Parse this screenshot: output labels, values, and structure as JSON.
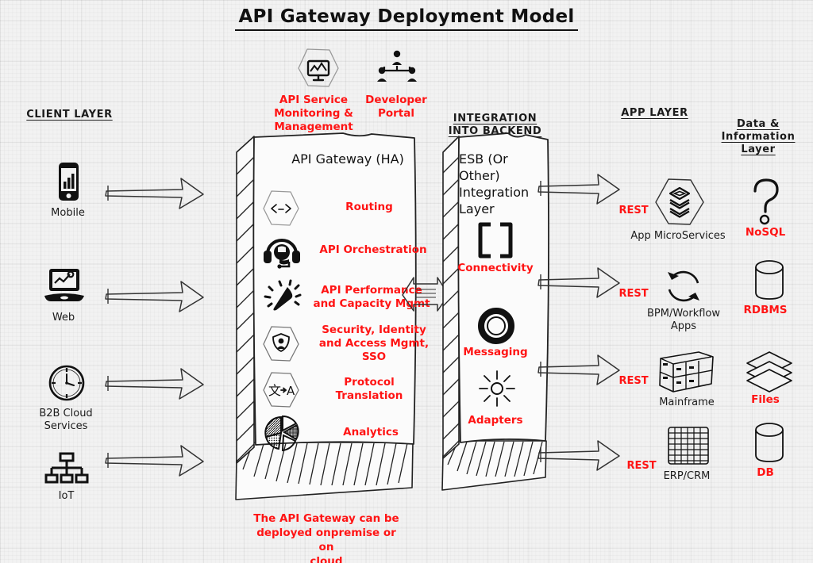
{
  "title": "API Gateway Deployment Model",
  "top_icons": [
    {
      "name": "api-service-monitoring",
      "label": "API Service\nMonitoring &\nManagement",
      "icon": "monitor-hexagon-icon"
    },
    {
      "name": "developer-portal",
      "label": "Developer Portal",
      "icon": "people-org-icon"
    }
  ],
  "layers": {
    "client": "CLIENT LAYER",
    "integration": "INTEGRATION\nINTO BACKEND",
    "app": "APP LAYER",
    "data": "Data & Information\nLayer"
  },
  "client_nodes": [
    {
      "label": "Mobile",
      "icon": "mobile-phone-icon"
    },
    {
      "label": "Web",
      "icon": "laptop-icon"
    },
    {
      "label": "B2B Cloud\nServices",
      "icon": "clock-icon"
    },
    {
      "label": "IoT",
      "icon": "network-tree-icon"
    }
  ],
  "gateway": {
    "title": "API Gateway (HA)",
    "features": [
      {
        "label": "Routing",
        "icon": "code-brackets-hexagon-icon"
      },
      {
        "label": "API Orchestration",
        "icon": "headset-icon"
      },
      {
        "label": "API Performance\nand Capacity Mgmt",
        "icon": "speedometer-icon"
      },
      {
        "label": "Security, Identity\nand Access Mgmt,\nSSO",
        "icon": "shield-person-hexagon-icon"
      },
      {
        "label": "Protocol\nTranslation",
        "icon": "translate-hexagon-icon"
      },
      {
        "label": "Analytics",
        "icon": "pie-chart-icon"
      }
    ],
    "caption": "The API Gateway can be\ndeployed onpremise or on\ncloud"
  },
  "esb": {
    "title": "ESB (Or\nOther)\nIntegration\nLayer",
    "features": [
      {
        "label": "Connectivity",
        "icon": "brackets-icon"
      },
      {
        "label": "Messaging",
        "icon": "ring-icon"
      },
      {
        "label": "Adapters",
        "icon": "sunburst-icon"
      }
    ]
  },
  "app_nodes": [
    {
      "label": "App MicroServices",
      "icon": "layers-hexagon-icon",
      "protocol": "REST"
    },
    {
      "label": "BPM/Workflow\nApps",
      "icon": "cycle-arrows-icon",
      "protocol": "REST"
    },
    {
      "label": "Mainframe",
      "icon": "server-racks-icon",
      "protocol": "REST"
    },
    {
      "label": "ERP/CRM",
      "icon": "grid-icon",
      "protocol": "REST"
    }
  ],
  "data_nodes": [
    {
      "label": "NoSQL",
      "icon": "question-mark-icon"
    },
    {
      "label": "RDBMS",
      "icon": "cylinder-icon"
    },
    {
      "label": "Files",
      "icon": "stacked-sheets-icon"
    },
    {
      "label": "DB",
      "icon": "cylinder-icon"
    }
  ],
  "colors": {
    "accent_red": "#ff1414",
    "ink": "#1b1b1b",
    "paper": "#f2f2f2"
  }
}
